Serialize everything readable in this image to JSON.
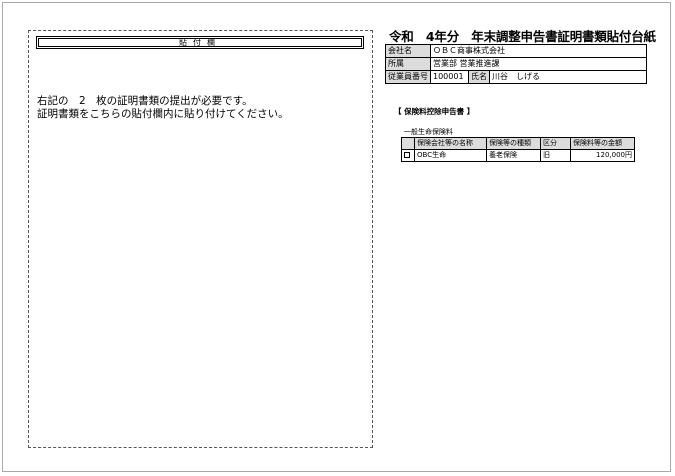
{
  "paste": {
    "header": "貼付欄",
    "instruction_line1": "右記の　2　枚の証明書類の提出が必要です。",
    "instruction_line2": "証明書類をこちらの貼付欄内に貼り付けてください。"
  },
  "document": {
    "title": "令和　4年分　年末調整申告書証明書類貼付台紙"
  },
  "info": {
    "company_label": "会社名",
    "company_value": "ＯＢＣ商事株式会社",
    "dept_label": "所属",
    "dept_value": "営業部 営業推進課",
    "empno_label": "従業員番号",
    "empno_value": "100001",
    "name_label": "氏名",
    "name_value": "川谷　しげる"
  },
  "insurance": {
    "section_title": "【 保険料控除申告書 】",
    "subsection_title": "一般生命保険料",
    "headers": [
      "保険会社等の名称",
      "保険等の種類",
      "区分",
      "保険料等の金額"
    ],
    "rows": [
      {
        "company": "OBC生命",
        "type": "養老保険",
        "category": "旧",
        "amount": "120,000円",
        "checked": false
      }
    ]
  }
}
